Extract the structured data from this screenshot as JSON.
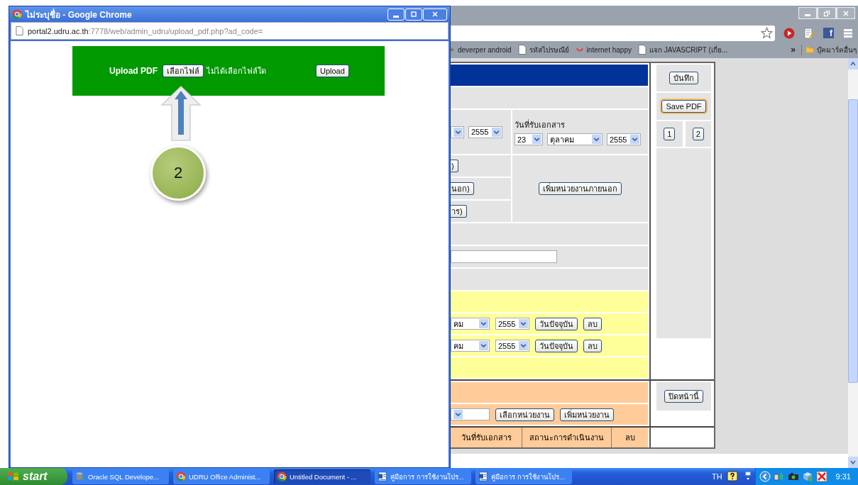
{
  "popup": {
    "title": "ไม่ระบุชื่อ - Google Chrome",
    "address_host": "portal2.udru.ac.th",
    "address_path": ":7778/web/admin_udru/upload_pdf.php?ad_code=",
    "upload": {
      "label": "Upload PDF",
      "choose_button": "เลือกไฟล์",
      "file_status": "ไม่ได้เลือกไฟล์ใด",
      "upload_button": "Upload"
    },
    "callout": {
      "number": "2"
    }
  },
  "browser": {
    "toolbar_badge": "f",
    "bookmarks": [
      {
        "label": "deverper android",
        "kind": "play"
      },
      {
        "label": "รหัสไปรษณีย์",
        "kind": "page"
      },
      {
        "label": "internet happy",
        "kind": "arc"
      },
      {
        "label": "แจก JAVASCRIPT (เกี่ย...",
        "kind": "page"
      }
    ],
    "overflow": "»",
    "other_bookmarks": "บุ๊คมาร์คอื่นๆ"
  },
  "form": {
    "date_row": {
      "left_year": "2555",
      "label": "วันที่รับเอกสาร",
      "day": "23",
      "month": "ตุลาคม",
      "year": "2555"
    },
    "cut_buttons": [
      ")",
      "นอก)",
      "าร)"
    ],
    "add_external_button": "เพิ่มหน่วยงานภายนอก",
    "date_entries": [
      {
        "month": "คม",
        "year": "2555",
        "today_button": "วันปัจจุบัน",
        "delete_button": "ลบ"
      },
      {
        "month": "คม",
        "year": "2555",
        "today_button": "วันปัจจุบัน",
        "delete_button": "ลบ"
      }
    ],
    "unit_buttons": [
      "เลือกหน่วยงาน",
      "เพิ่มหน่วยงาน"
    ],
    "columns": [
      "วันที่รับเอกสาร",
      "สถานะการดำเนินงาน",
      "ลบ"
    ],
    "side": {
      "save_button": "บันทึก",
      "save_pdf_button": "Save PDF",
      "pages": [
        "1",
        "2"
      ],
      "close_button": "ปิดหน้านี้"
    }
  },
  "taskbar": {
    "start": "start",
    "tasks": [
      {
        "label": "Oracle SQL Develope...",
        "kind": "database",
        "selected": false
      },
      {
        "label": "UDRU Office Administ...",
        "kind": "chrome",
        "selected": false
      },
      {
        "label": "Untitled Document - ...",
        "kind": "chrome",
        "selected": true
      },
      {
        "label": "คู่มือการ การใช้งานโปร...",
        "kind": "doc",
        "selected": false
      },
      {
        "label": "คู่มือการ การใช้งานโปร...",
        "kind": "doc",
        "selected": false
      }
    ],
    "language": "TH",
    "time": "9:31"
  }
}
